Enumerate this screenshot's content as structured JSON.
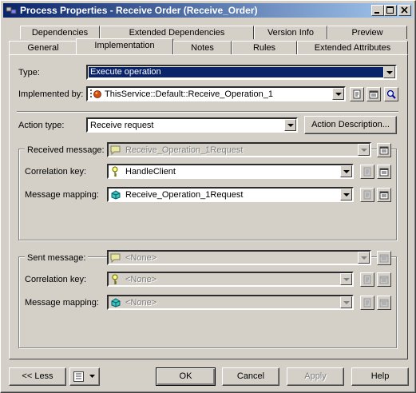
{
  "window": {
    "title": "Process Properties - Receive Order (Receive_Order)"
  },
  "tabs_row1": [
    "Dependencies",
    "Extended Dependencies",
    "Version Info",
    "Preview"
  ],
  "tabs_row2": [
    "General",
    "Implementation",
    "Notes",
    "Rules",
    "Extended Attributes"
  ],
  "selected_tab": "Implementation",
  "form": {
    "type_label": "Type:",
    "type_value": "Execute operation",
    "implemented_by_label": "Implemented by:",
    "implemented_by_value": "ThisService::Default::Receive_Operation_1",
    "action_type_label": "Action type:",
    "action_type_value": "Receive request",
    "action_description_button": "Action Description..."
  },
  "received": {
    "group_label": "Received message:",
    "message_value": "Receive_Operation_1Request",
    "correlation_label": "Correlation key:",
    "correlation_value": "HandleClient",
    "mapping_label": "Message mapping:",
    "mapping_value": "Receive_Operation_1Request"
  },
  "sent": {
    "group_label": "Sent message:",
    "message_value": "<None>",
    "correlation_label": "Correlation key:",
    "correlation_value": "<None>",
    "mapping_label": "Message mapping:",
    "mapping_value": "<None>"
  },
  "footer": {
    "less_button": "<< Less",
    "ok_button": "OK",
    "cancel_button": "Cancel",
    "apply_button": "Apply",
    "help_button": "Help"
  }
}
